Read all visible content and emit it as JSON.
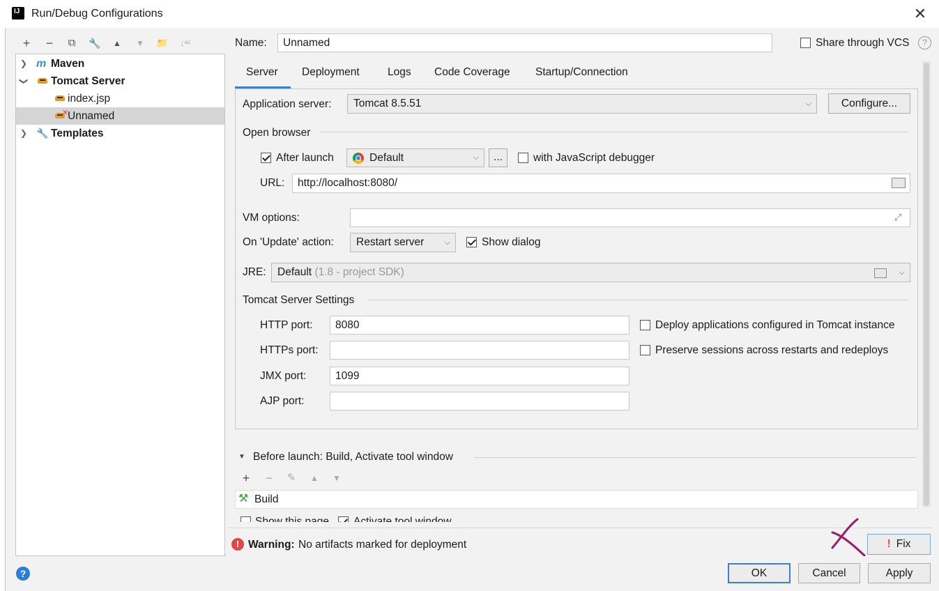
{
  "window": {
    "title": "Run/Debug Configurations"
  },
  "toolbar": {
    "add": "+",
    "remove": "−",
    "copy": "⧉",
    "edit": "🔧",
    "up": "▲",
    "down": "▼",
    "folder": "📁",
    "sort": "↓ᵃᶻ"
  },
  "tree": {
    "items": [
      {
        "label": "Maven",
        "icon": "maven-icon"
      },
      {
        "label": "Tomcat Server",
        "icon": "tomcat-icon"
      },
      {
        "label": "index.jsp",
        "icon": "tomcat-icon"
      },
      {
        "label": "Unnamed",
        "icon": "tomcat-error-icon"
      },
      {
        "label": "Templates",
        "icon": "wrench-icon"
      }
    ]
  },
  "header": {
    "name_label": "Name:",
    "name_value": "Unnamed",
    "share_label": "Share through VCS"
  },
  "tabs": [
    "Server",
    "Deployment",
    "Logs",
    "Code Coverage",
    "Startup/Connection"
  ],
  "server": {
    "app_server_label": "Application server:",
    "app_server_value": "Tomcat 8.5.51",
    "configure_button": "Configure...",
    "open_browser_label": "Open browser",
    "after_launch_label": "After launch",
    "after_launch_checked": true,
    "browser_value": "Default",
    "browse_button": "...",
    "js_debugger_label": "with JavaScript debugger",
    "url_label": "URL:",
    "url_value": "http://localhost:8080/",
    "vm_options_label": "VM options:",
    "vm_options_value": "",
    "update_action_label": "On 'Update' action:",
    "update_action_value": "Restart server",
    "show_dialog_label": "Show dialog",
    "show_dialog_checked": true,
    "jre_label": "JRE:",
    "jre_value": "Default",
    "jre_hint": "(1.8 - project SDK)",
    "tomcat_settings_label": "Tomcat Server Settings",
    "http_port_label": "HTTP port:",
    "http_port_value": "8080",
    "https_port_label": "HTTPs port:",
    "https_port_value": "",
    "jmx_port_label": "JMX port:",
    "jmx_port_value": "1099",
    "ajp_port_label": "AJP port:",
    "ajp_port_value": "",
    "deploy_apps_label": "Deploy applications configured in Tomcat instance",
    "preserve_sessions_label": "Preserve sessions across restarts and redeploys"
  },
  "before_launch": {
    "label": "Before launch: Build, Activate tool window",
    "items": [
      "Build"
    ],
    "show_page_label": "Show this page",
    "activate_tool_label": "Activate tool window"
  },
  "warning": {
    "bold": "Warning:",
    "text": "No artifacts marked for deployment",
    "fix_button": "Fix"
  },
  "footer": {
    "ok": "OK",
    "cancel": "Cancel",
    "apply": "Apply"
  }
}
